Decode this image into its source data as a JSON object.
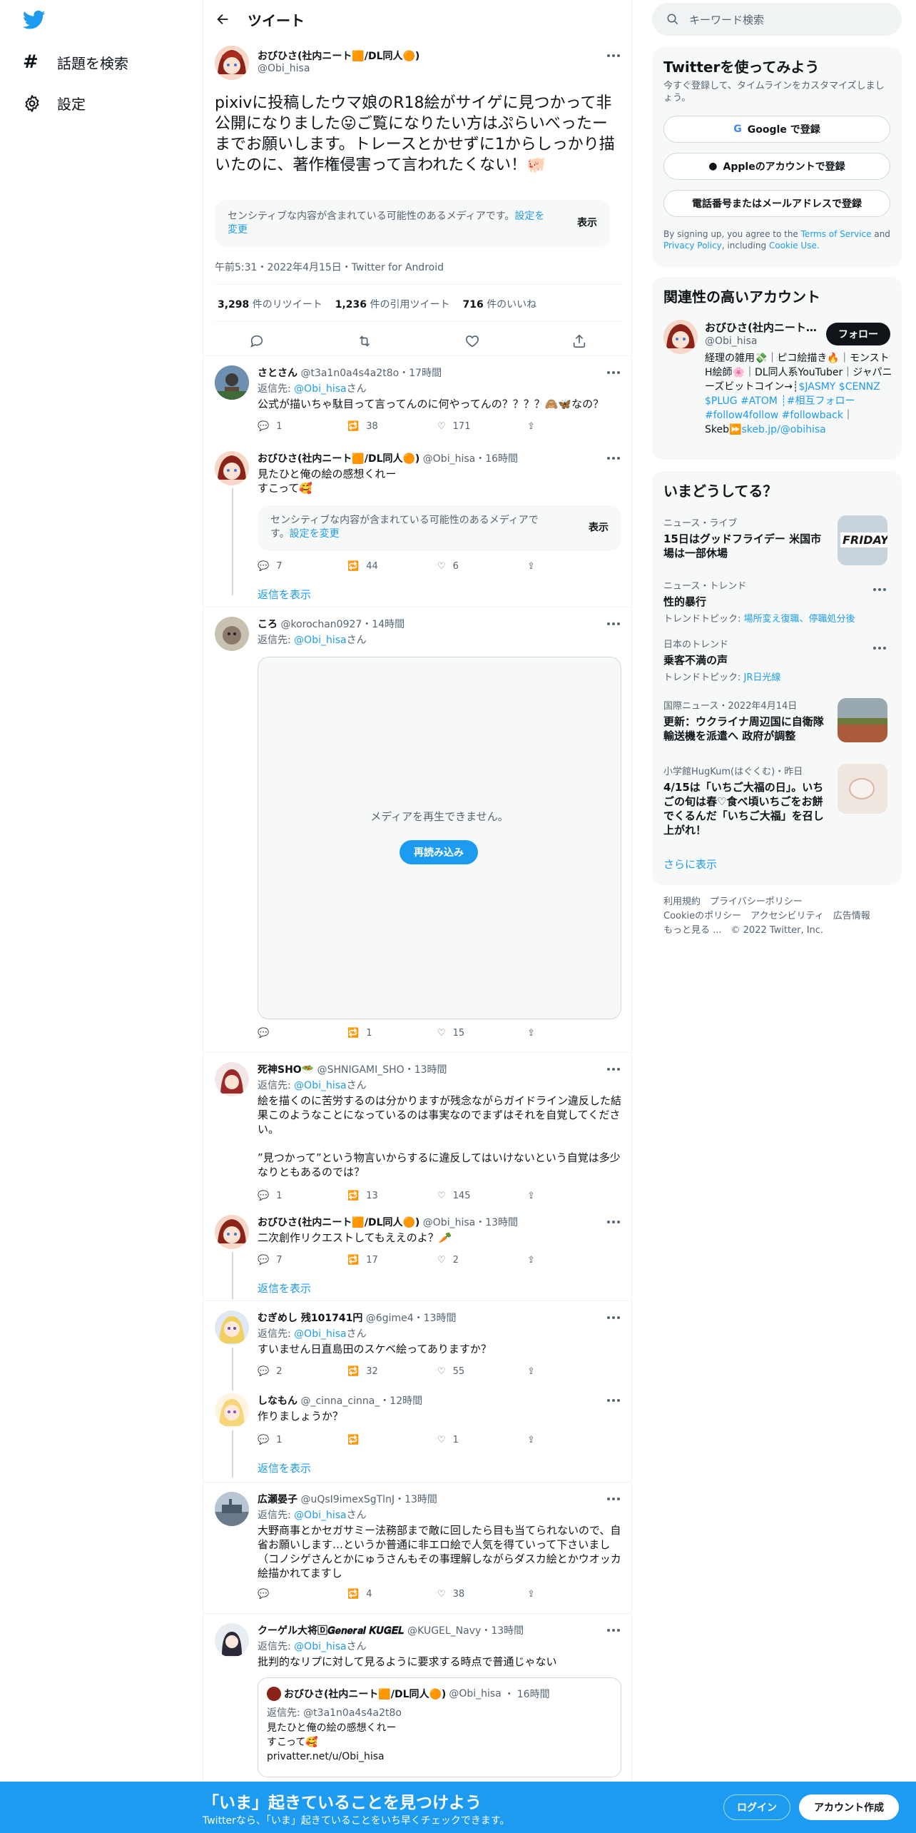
{
  "nav": {
    "explore_label": "話題を検索",
    "settings_label": "設定"
  },
  "header": {
    "title": "ツイート"
  },
  "main_tweet": {
    "name": "おびひさ(社内ニート🟧/DL同人🟠)",
    "handle": "@Obi_hisa",
    "text": "pixivに投稿したウマ娘のR18絵がサイゲに見つかって非公開になりました😛ご覧になりたい方はぷらいべったーまでお願いします。トレースとかせずに1からしっかり描いたのに、著作権侵害って言われたくない！🐖",
    "sensitive_text": "センシティブな内容が含まれている可能性のあるメディアです。",
    "sensitive_link": "設定を変更",
    "show_label": "表示",
    "timestamp": "午前5:31・2022年4月15日・Twitter for Android",
    "retweets": "3,298",
    "retweets_label": "件のリツイート",
    "quotes": "1,236",
    "quotes_label": "件の引用ツイート",
    "likes": "716",
    "likes_label": "件のいいね"
  },
  "replies": [
    {
      "name": "さとさん",
      "handle": "@t3a1n0a4s4a2t8o",
      "time": "17時間",
      "reply_to_prefix": "返信先: ",
      "reply_to": "@Obi_hisa",
      "reply_to_suffix": "さん",
      "text": "公式が描いちゃ駄目って言ってんのに何やってんの？？？？🙈🦋なの？",
      "replies": "1",
      "retweets": "38",
      "likes": "171"
    },
    {
      "name": "おびひさ(社内ニート🟧/DL同人🟠)",
      "handle": "@Obi_hisa",
      "time": "16時間",
      "text": "見たひと俺の絵の感想くれー\nすこって🥰",
      "sensitive_text": "センシティブな内容が含まれている可能性のあるメディアです。",
      "sensitive_link": "設定を変更",
      "show_label": "表示",
      "replies": "7",
      "retweets": "44",
      "likes": "6",
      "show_replies": "返信を表示"
    },
    {
      "name": "ころ",
      "handle": "@korochan0927",
      "time": "14時間",
      "reply_to_prefix": "返信先: ",
      "reply_to": "@Obi_hisa",
      "reply_to_suffix": "さん",
      "media_error": "メディアを再生できません。",
      "reload_label": "再読み込み",
      "replies": "",
      "retweets": "1",
      "likes": "15"
    },
    {
      "name": "死神SHO🥗",
      "handle": "@SHNIGAMI_SHO",
      "time": "13時間",
      "reply_to_prefix": "返信先: ",
      "reply_to": "@Obi_hisa",
      "reply_to_suffix": "さん",
      "text": "絵を描くのに苦労するのは分かりますが残念ながらガイドライン違反した結果このようなことになっているのは事実なのでまずはそれを自覚してください。\n\n”見つかって”という物言いからするに違反してはいけないという自覚は多少なりともあるのでは？",
      "replies": "1",
      "retweets": "13",
      "likes": "145"
    },
    {
      "name": "おびひさ(社内ニート🟧/DL同人🟠)",
      "handle": "@Obi_hisa",
      "time": "13時間",
      "text": "二次創作リクエストしてもええのよ？🥕",
      "replies": "7",
      "retweets": "17",
      "likes": "2",
      "show_replies": "返信を表示"
    },
    {
      "name": "むぎめし 残101741円",
      "handle": "@6gime4",
      "time": "13時間",
      "reply_to_prefix": "返信先: ",
      "reply_to": "@Obi_hisa",
      "reply_to_suffix": "さん",
      "text": "すいません日直島田のスケベ絵ってありますか？",
      "replies": "2",
      "retweets": "32",
      "likes": "55"
    },
    {
      "name": "しなもん",
      "handle": "@_cinna_cinna_",
      "time": "12時間",
      "text": "作りましょうか？",
      "replies": "1",
      "retweets": "",
      "likes": "1",
      "show_replies": "返信を表示"
    },
    {
      "name": "広瀬晏子",
      "handle": "@uQsI9imexSgTlnJ",
      "time": "13時間",
      "reply_to_prefix": "返信先: ",
      "reply_to": "@Obi_hisa",
      "reply_to_suffix": "さん",
      "text": "大野商事とかセガサミー法務部まで敵に回したら目も当てられないので、自省お願いします…というか普通に非エロ絵で人気を得ていって下さいまし（コノシゲさんとかにゅうさんもその事理解しながらダスカ絵とかウオッカ絵描かれてますし",
      "replies": "",
      "retweets": "4",
      "likes": "38"
    },
    {
      "name": "クーゲル大将🄳𝑮𝒆𝒏𝒆𝒓𝒂𝒍 𝑲𝑼𝑮𝑬𝑳",
      "handle": "@KUGEL_Navy",
      "time": "13時間",
      "reply_to_prefix": "返信先: ",
      "reply_to": "@Obi_hisa",
      "reply_to_suffix": "さん",
      "text": "批判的なリプに対して見るように要求する時点で普通じゃない",
      "quote": {
        "name": "おびひさ(社内ニート🟧/DL同人🟠)",
        "handle": "@Obi_hisa",
        "time": "16時間",
        "reply_to_prefix": "返信先: ",
        "reply_to": "@t3a1n0a4s4a2t8o",
        "text": "見たひと俺の絵の感想くれー\nすこって🥰\nprivatter.net/u/Obi_hisa"
      }
    }
  ],
  "search": {
    "placeholder": "キーワード検索"
  },
  "signup": {
    "title": "Twitterを使ってみよう",
    "subtitle": "今すぐ登録して、タイムラインをカスタマイズしましょう。",
    "google": "Google で登録",
    "apple": "Appleのアカウントで登録",
    "phone": "電話番号またはメールアドレスで登録",
    "terms_prefix": "By signing up, you agree to the ",
    "terms_link": "Terms of Service",
    "terms_and": " and ",
    "privacy_link": "Privacy Policy",
    "including": ", including ",
    "cookie_link": "Cookie Use."
  },
  "related": {
    "title": "関連性の高いアカウント",
    "name": "おびひさ(社内ニート…",
    "handle": "@Obi_hisa",
    "follow_label": "フォロー",
    "bio_plain_1": "経理の雑用💸｜ピコ絵描き🔥｜モンストH絵師🌸｜DL同人系YouTuber｜ジャパニーズビットコイン→┊",
    "bio_link_1": "$JASMY $CENNZ $PLUG #ATOM ┊#相互フォロー #follow4follow #followback",
    "bio_plain_2": "｜Skeb⏩",
    "bio_link_2": "skeb.jp/@obihisa"
  },
  "trends": {
    "title": "いまどうしてる？",
    "items": [
      {
        "category": "ニュース・ライブ",
        "title": "15日はグッドフライデー 米国市場は一部休場"
      },
      {
        "category": "ニュース・トレンド",
        "title": "性的暴行",
        "sub_prefix": "トレンドトピック: ",
        "sub_link": "場所変え復職、停職処分後"
      },
      {
        "category": "日本のトレンド",
        "title": "乗客不満の声",
        "sub_prefix": "トレンドトピック: ",
        "sub_link": "JR日光線"
      },
      {
        "category": "国際ニュース・2022年4月14日",
        "title": "更新：ウクライナ周辺国に自衛隊輸送機を派遣へ 政府が調整"
      },
      {
        "category": "小学館HugKum(はぐくむ)",
        "time": "・昨日",
        "title": "4/15は「いちご大福の日」。いちごの旬は春♡食べ頃いちごをお餅でくるんだ「いちご大福」を召し上がれ！"
      }
    ],
    "show_more": "さらに表示",
    "friday_text": "FRIDAY"
  },
  "footer": {
    "line1": "利用規約　プライバシーポリシー",
    "line2": "Cookieのポリシー　アクセシビリティ　広告情報",
    "line3": "もっと見る ...　© 2022 Twitter, Inc."
  },
  "bottombar": {
    "headline": "「いま」起きていることを見つけよう",
    "sub": "Twitterなら、「いま」起きていることをいち早くチェックできます。",
    "login": "ログイン",
    "signup": "アカウント作成"
  },
  "colors": {
    "accent": "#1d9bf0",
    "text": "#0f1419",
    "muted": "#536471",
    "bg_card": "#f7f9f9"
  }
}
